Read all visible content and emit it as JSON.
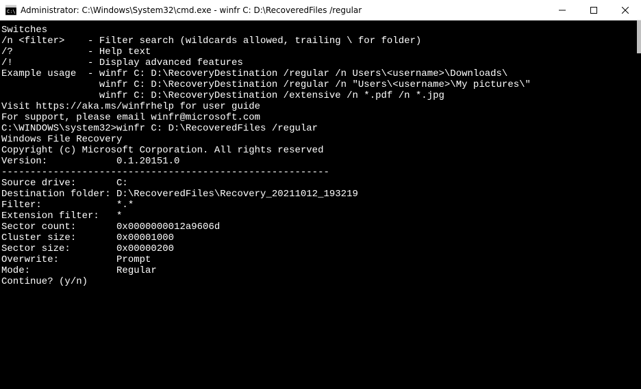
{
  "window": {
    "title": "Administrator: C:\\Windows\\System32\\cmd.exe - winfr  C: D:\\RecoveredFiles /regular"
  },
  "terminal": {
    "lines": {
      "l0": "Switches",
      "l1": "/n <filter>    - Filter search (wildcards allowed, trailing \\ for folder)",
      "l2": "/?             - Help text",
      "l3": "/!             - Display advanced features",
      "l4": "",
      "l5": "Example usage  - winfr C: D:\\RecoveryDestination /regular /n Users\\<username>\\Downloads\\",
      "l6": "                 winfr C: D:\\RecoveryDestination /regular /n \"Users\\<username>\\My pictures\\\"",
      "l7": "                 winfr C: D:\\RecoveryDestination /extensive /n *.pdf /n *.jpg",
      "l8": "",
      "l9": "",
      "l10": "Visit https://aka.ms/winfrhelp for user guide",
      "l11": "For support, please email winfr@microsoft.com",
      "l12": "",
      "l13": "C:\\WINDOWS\\system32>winfr C: D:\\RecoveredFiles /regular",
      "l14": "",
      "l15": "Windows File Recovery",
      "l16": "Copyright (c) Microsoft Corporation. All rights reserved",
      "l17": "Version:            0.1.20151.0",
      "l18": "---------------------------------------------------------",
      "l19": "",
      "l20": "Source drive:       C:",
      "l21": "Destination folder: D:\\RecoveredFiles\\Recovery_20211012_193219",
      "l22": "Filter:             *.*",
      "l23": "Extension filter:   *",
      "l24": "",
      "l25": "Sector count:       0x0000000012a9606d",
      "l26": "Cluster size:       0x00001000",
      "l27": "Sector size:        0x00000200",
      "l28": "Overwrite:          Prompt",
      "l29": "Mode:               Regular",
      "l30": "",
      "l31": "",
      "l32": "Continue? (y/n) "
    }
  }
}
